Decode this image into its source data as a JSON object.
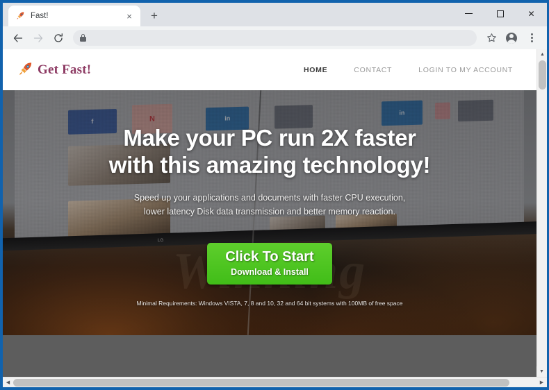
{
  "browser": {
    "tab": {
      "title": "Fast!",
      "favicon": "rocket-icon",
      "close_label": "×"
    },
    "new_tab_label": "+",
    "window_controls": {
      "minimize": "minimize-icon",
      "maximize": "maximize-icon",
      "close": "✕"
    },
    "toolbar": {
      "back": "←",
      "forward": "→",
      "reload": "⟳",
      "bookmark": "☆",
      "profile": "profile-avatar-icon",
      "menu": "kebab-menu-icon",
      "omnibox_value": "",
      "omnibox_placeholder": "",
      "security_icon": "lock-icon"
    },
    "scrollbars": {
      "up": "▲",
      "down": "▼",
      "left": "◀",
      "right": "▶"
    }
  },
  "site": {
    "logo": {
      "icon": "🚀",
      "text": "Get Fast!",
      "color": "#8d3a63"
    },
    "nav": [
      {
        "label": "HOME",
        "active": true
      },
      {
        "label": "CONTACT",
        "active": false
      },
      {
        "label": "LOGIN TO MY ACCOUNT",
        "active": false
      }
    ],
    "hero": {
      "title_line1": "Make your PC run 2X faster",
      "title_line2": "with this amazing technology!",
      "subtitle_line1": "Speed up your applications and documents with faster CPU execution,",
      "subtitle_line2": "lower latency Disk data transmission and better memory reaction.",
      "cta_main": "Click To Start",
      "cta_sub": "Download & Install",
      "cta_color": "#4cc61f",
      "requirements": "Minimal Requirements: Windows VISTA, 7, 8 and 10, 32 and 64 bit systems with 100MB of free space",
      "background_watermark": "Winning",
      "monitor_label": "LG",
      "tiles": [
        {
          "kind": "fb",
          "letter": "f"
        },
        {
          "kind": "nflx",
          "letter": "N"
        },
        {
          "kind": "li",
          "letter": "in"
        },
        {
          "kind": "grey",
          "letter": ""
        },
        {
          "kind": "li",
          "letter": "in"
        },
        {
          "kind": "pink",
          "letter": ""
        },
        {
          "kind": "grey",
          "letter": ""
        }
      ]
    }
  }
}
